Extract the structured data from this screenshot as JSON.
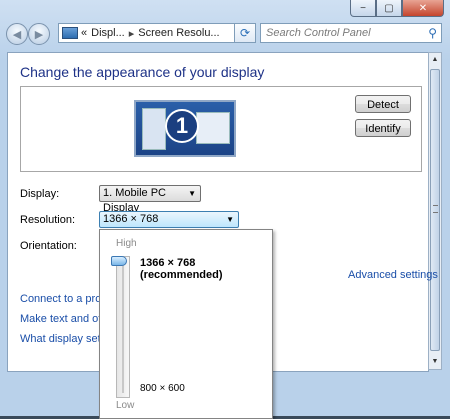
{
  "window": {
    "minimize": "−",
    "maximize": "▢",
    "close": "✕"
  },
  "nav": {
    "back": "◀",
    "forward": "▶",
    "breadcrumb_prefix": "«",
    "breadcrumb_1": "Displ...",
    "breadcrumb_2": "Screen Resolu...",
    "breadcrumb_sep": "▸",
    "search_placeholder": "Search Control Panel"
  },
  "main": {
    "title": "Change the appearance of your display",
    "monitor_number": "1",
    "detect_label": "Detect",
    "identify_label": "Identify",
    "display_label": "Display:",
    "display_value": "1. Mobile PC Display",
    "resolution_label": "Resolution:",
    "resolution_value": "1366 × 768 (recommended)",
    "orientation_label": "Orientation:",
    "advanced_settings": "Advanced settings",
    "link_connect": "Connect to a projec",
    "link_text_size": "Make text and other",
    "link_what_display": "What display setting"
  },
  "resolution_popup": {
    "high_label": "High",
    "low_label": "Low",
    "max_option": "1366 × 768 (recommended)",
    "min_option": "800 × 600",
    "slider_position": 1.0
  }
}
